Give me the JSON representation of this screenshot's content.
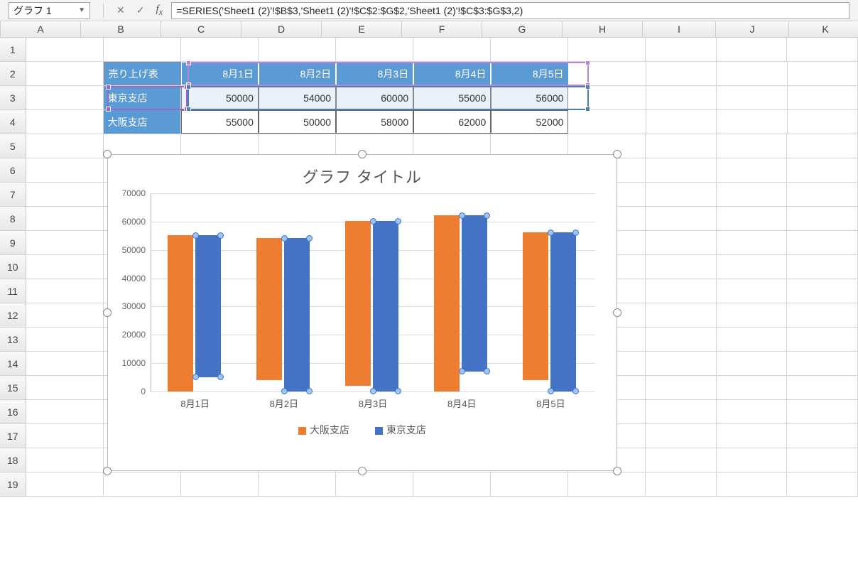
{
  "name_box": "グラフ 1",
  "formula": "=SERIES('Sheet1 (2)'!$B$3,'Sheet1 (2)'!$C$2:$G$2,'Sheet1 (2)'!$C$3:$G$3,2)",
  "columns": [
    "A",
    "B",
    "C",
    "D",
    "E",
    "F",
    "G",
    "H",
    "I",
    "J",
    "K"
  ],
  "rows_count": 19,
  "table": {
    "header": {
      "label": "売り上げ表",
      "dates": [
        "8月1日",
        "8月2日",
        "8月3日",
        "8月4日",
        "8月5日"
      ]
    },
    "row_tokyo": {
      "label": "東京支店",
      "values": [
        50000,
        54000,
        60000,
        55000,
        56000
      ]
    },
    "row_osaka": {
      "label": "大阪支店",
      "values": [
        55000,
        50000,
        58000,
        62000,
        52000
      ]
    }
  },
  "chart_data": {
    "type": "bar",
    "title": "グラフ タイトル",
    "categories": [
      "8月1日",
      "8月2日",
      "8月3日",
      "8月4日",
      "8月5日"
    ],
    "series": [
      {
        "name": "大阪支店",
        "values": [
          55000,
          50000,
          58000,
          62000,
          52000
        ],
        "color": "#ed7d31"
      },
      {
        "name": "東京支店",
        "values": [
          50000,
          54000,
          60000,
          55000,
          56000
        ],
        "color": "#4472c4",
        "selected": true
      }
    ],
    "xlabel": "",
    "ylabel": "",
    "ylim": [
      0,
      70000
    ],
    "yticks": [
      0,
      10000,
      20000,
      30000,
      40000,
      50000,
      60000,
      70000
    ],
    "legend_position": "bottom",
    "grid": true
  }
}
